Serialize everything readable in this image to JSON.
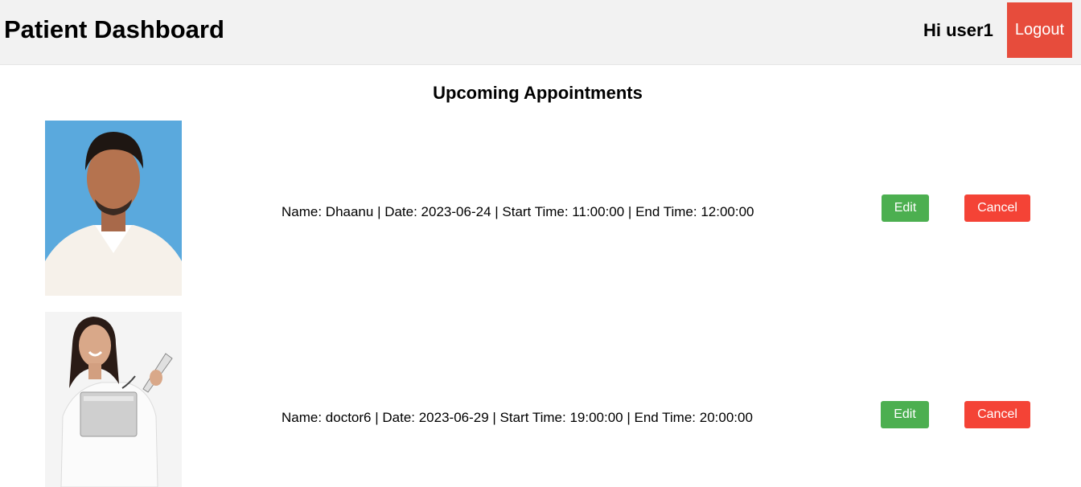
{
  "header": {
    "title": "Patient Dashboard",
    "greeting": "Hi user1",
    "logout_label": "Logout"
  },
  "main": {
    "section_title": "Upcoming Appointments",
    "appointments": [
      {
        "text": "Name: Dhaanu | Date: 2023-06-24 | Start Time: 11:00:00 | End Time: 12:00:00",
        "edit_label": "Edit",
        "cancel_label": "Cancel"
      },
      {
        "text": "Name: doctor6 | Date: 2023-06-29 | Start Time: 19:00:00 | End Time: 20:00:00",
        "edit_label": "Edit",
        "cancel_label": "Cancel"
      }
    ]
  },
  "colors": {
    "header_bg": "#f2f2f2",
    "logout": "#e74c3c",
    "edit": "#4caf50",
    "cancel": "#f44336"
  }
}
